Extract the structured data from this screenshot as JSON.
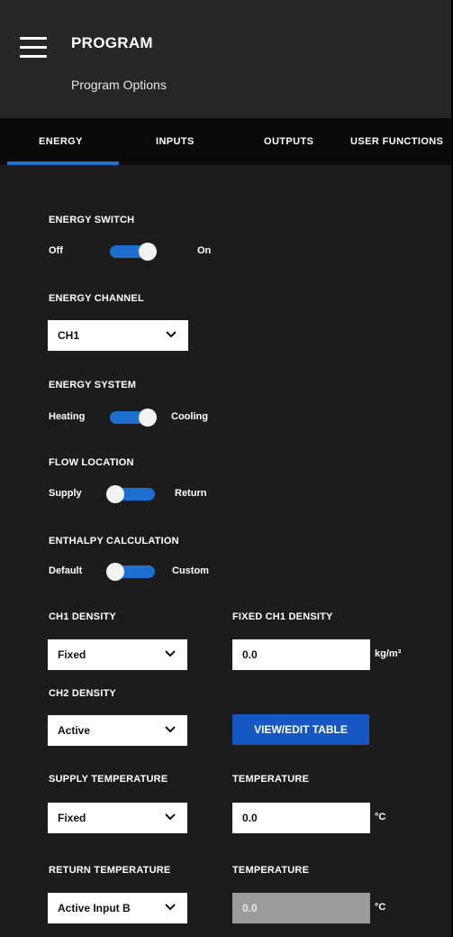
{
  "header": {
    "title": "PROGRAM",
    "subtitle": "Program Options"
  },
  "tabs": [
    "ENERGY",
    "INPUTS",
    "OUTPUTS",
    "USER FUNCTIONS"
  ],
  "active_tab": "ENERGY",
  "colors": {
    "accent": "#1f6fd1",
    "button": "#1558c4",
    "background": "#1c1c1c"
  },
  "energy_switch": {
    "label": "ENERGY SWITCH",
    "left": "Off",
    "right": "On",
    "state": "On"
  },
  "energy_channel": {
    "label": "ENERGY CHANNEL",
    "value": "CH1"
  },
  "energy_system": {
    "label": "ENERGY SYSTEM",
    "left": "Heating",
    "right": "Cooling",
    "state": "Cooling"
  },
  "flow_location": {
    "label": "FLOW LOCATION",
    "left": "Supply",
    "right": "Return",
    "state": "Supply"
  },
  "enthalpy": {
    "label": "ENTHALPY CALCULATION",
    "left": "Default",
    "right": "Custom",
    "state": "Default"
  },
  "ch1_density": {
    "label": "CH1 DENSITY",
    "value": "Fixed"
  },
  "fixed_ch1_density": {
    "label": "FIXED CH1 DENSITY",
    "value": "0.0",
    "unit": "kg/m³"
  },
  "ch2_density": {
    "label": "CH2 DENSITY",
    "value": "Active"
  },
  "view_edit_button": "VIEW/EDIT TABLE",
  "supply_temperature": {
    "label": "SUPPLY TEMPERATURE",
    "value": "Fixed"
  },
  "supply_temp_value": {
    "label": "TEMPERATURE",
    "value": "0.0",
    "unit": "°C"
  },
  "return_temperature": {
    "label": "RETURN TEMPERATURE",
    "value": "Active Input B"
  },
  "return_temp_value": {
    "label": "TEMPERATURE",
    "value": "0.0",
    "unit": "°C"
  }
}
